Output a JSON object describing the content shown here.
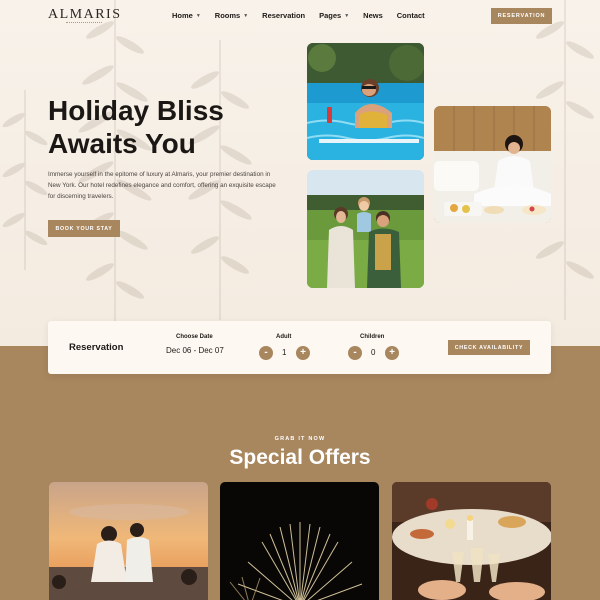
{
  "brand": {
    "logo": "ALMARIS",
    "logo_sub": "HOTEL"
  },
  "nav": {
    "items": [
      {
        "label": "Home",
        "has_dropdown": true
      },
      {
        "label": "Rooms",
        "has_dropdown": true
      },
      {
        "label": "Reservation",
        "has_dropdown": false
      },
      {
        "label": "Pages",
        "has_dropdown": true
      },
      {
        "label": "News",
        "has_dropdown": false
      },
      {
        "label": "Contact",
        "has_dropdown": false
      }
    ],
    "cta": "RESERVATION"
  },
  "hero": {
    "headline_line1": "Holiday Bliss",
    "headline_line2": "Awaits You",
    "description": "Immerse yourself in the epitome of luxury at Almaris, your premier destination in New York. Our hotel redefines elegance and comfort, offering an exquisite escape for discerning travelers.",
    "cta": "BOOK YOUR STAY"
  },
  "reservation": {
    "title": "Reservation",
    "date_label": "Choose Date",
    "date_value": "Dec 06 - Dec 07",
    "adult_label": "Adult",
    "adult_value": "1",
    "children_label": "Children",
    "children_value": "0",
    "minus": "-",
    "plus": "+",
    "cta": "CHECK AVAILABILITY"
  },
  "offers": {
    "eyebrow": "GRAB IT NOW",
    "title": "Special Offers"
  },
  "colors": {
    "accent": "#a8865e",
    "hero_bg": "#f7f1ea",
    "dark_text": "#1d1a17"
  }
}
